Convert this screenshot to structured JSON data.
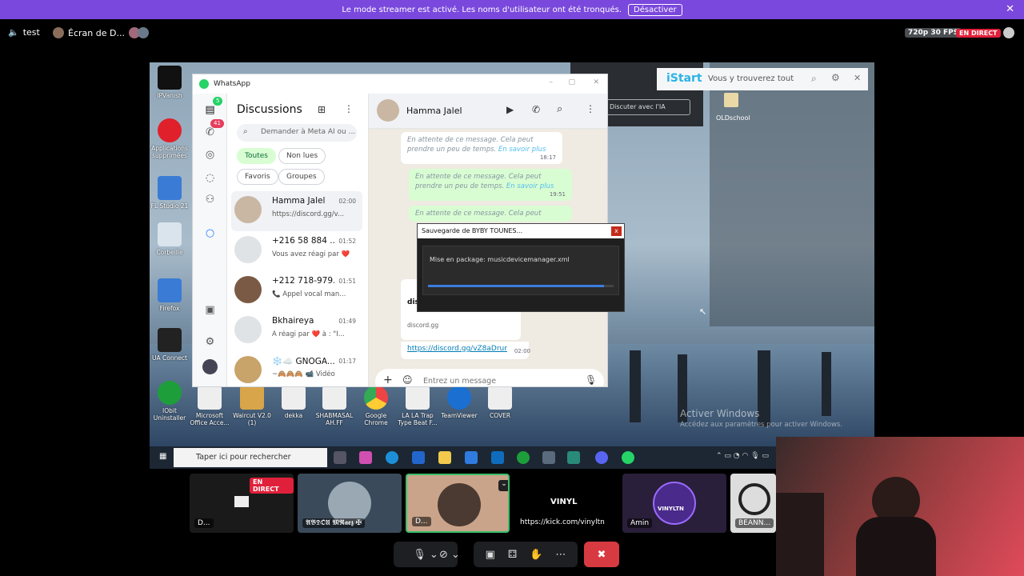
{
  "banner": {
    "text": "Le mode streamer est activé. Les noms d'utilisateur ont été tronqués.",
    "button": "Désactiver"
  },
  "top": {
    "channel": "test",
    "screen_label": "Écran de D...",
    "quality": "720p 30 FPS",
    "live": "EN DIRECT"
  },
  "whatsapp": {
    "app_title": "WhatsApp",
    "list_title": "Discussions",
    "search_placeholder": "Demander à Meta AI ou ...",
    "filters": [
      "Toutes",
      "Non lues",
      "Favoris",
      "Groupes"
    ],
    "rail_badges": {
      "chats": "5",
      "calls": "41"
    },
    "chats": [
      {
        "name": "Hamma Jalel",
        "time": "02:00",
        "preview": "https://discord.gg/v..."
      },
      {
        "name": "+216 58 884 ...",
        "time": "01:52",
        "preview": "Vous avez réagi par ❤️"
      },
      {
        "name": "+212 718-979...",
        "time": "01:51",
        "preview": "📞 Appel vocal man..."
      },
      {
        "name": "Bkhaireya",
        "time": "01:49",
        "preview": "A réagi par ❤️ à  : \"I..."
      },
      {
        "name": "❄️☁️ GNOGA...",
        "time": "01:17",
        "preview": "~🙈🙈🙈 📹 Vidéo"
      }
    ],
    "conversation": {
      "contact": "Hamma Jalel",
      "waiting_text": "En attente de ce message. Cela peut prendre un peu de temps.",
      "learn_more": "En savoir plus",
      "times": [
        "18:17",
        "19:51"
      ],
      "waiting_partial": "En attente de ce message. Cela peut",
      "link_title": "dis",
      "link_domain": "discord.gg",
      "link": "https://discord.gg/vZ8aDrur",
      "link_time": "02:00",
      "composer_placeholder": "Entrez un message"
    }
  },
  "dialog": {
    "title": "Sauvegarde de BYBY TOUNES...",
    "message": "Mise en package: musicdevicemanager.xml",
    "progress": 0.95
  },
  "istart": {
    "brand": "iStart",
    "placeholder": "Vous y trouverez tout",
    "chat_button": "Discuter avec l'IA"
  },
  "desktop": {
    "left_icons": [
      "IPVanish",
      "Applications supprimées",
      "FL Studio 21",
      "Corbeille",
      "Firefox",
      "UA Connect"
    ],
    "bottom_icons": [
      "IObit Uninstaller",
      "Microsoft Office Acce...",
      "Waircut V2.0 (1)",
      "dekka",
      "SHABMASAL AH.FF",
      "Google Chrome",
      "LA LA Trap Type Beat F...",
      "TeamViewer",
      "COVER"
    ],
    "folder": "OLDschool",
    "watermark_title": "Activer Windows",
    "watermark_sub": "Accédez aux paramètres pour activer Windows.",
    "taskbar_search": "Taper ici pour rechercher"
  },
  "tiles": [
    {
      "label": "D...",
      "live": "EN DIRECT"
    },
    {
      "label": "𝕬𝕭𝕯𝕺𝖀 𝕸𝕽𝖆𝖊𝖟 ✠"
    },
    {
      "label": "D..."
    },
    {
      "label": "https://kick.com/vinyltn",
      "brand": "VINYL"
    },
    {
      "label": "Amin",
      "brand": "VINYLTN"
    },
    {
      "label": "BEANN..."
    }
  ]
}
